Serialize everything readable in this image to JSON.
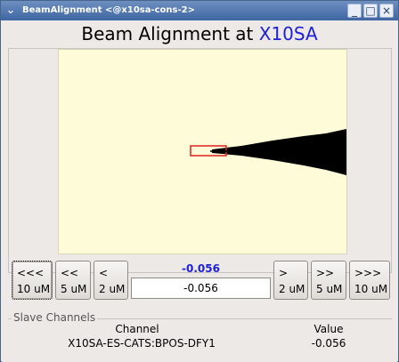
{
  "window": {
    "title": "BeamAlignment <@x10sa-cons-2>",
    "menu_icon": "chevron-down-icon",
    "min_icon": "minimize-icon",
    "max_icon": "maximize-icon",
    "close_icon": "close-icon",
    "menu_glyph": "⌄",
    "min_glyph": "_",
    "max_glyph": "□",
    "close_glyph": "×"
  },
  "header": {
    "prefix": "Beam Alignment at",
    "station": "X10SA",
    "station_color": "#1e20d8"
  },
  "plot": {
    "background": "#fefcd8",
    "marker_color": "#e02020",
    "beam_color": "#000000"
  },
  "controls": {
    "left": [
      {
        "symbol": "<<<",
        "step": "10 uM"
      },
      {
        "symbol": "<<",
        "step": "5 uM"
      },
      {
        "symbol": "<",
        "step": "2 uM"
      }
    ],
    "right": [
      {
        "symbol": ">",
        "step": "2 uM"
      },
      {
        "symbol": ">>",
        "step": "5 uM"
      },
      {
        "symbol": ">>>",
        "step": "10 uM"
      }
    ],
    "readback": "-0.056",
    "setpoint": "-0.056",
    "readback_color": "#1e20d8"
  },
  "slave_channels": {
    "title": "Slave Channels",
    "columns": [
      "Channel",
      "Value"
    ],
    "rows": [
      {
        "channel": "X10SA-ES-CATS:BPOS-DFY1",
        "value": "-0.056"
      }
    ]
  }
}
